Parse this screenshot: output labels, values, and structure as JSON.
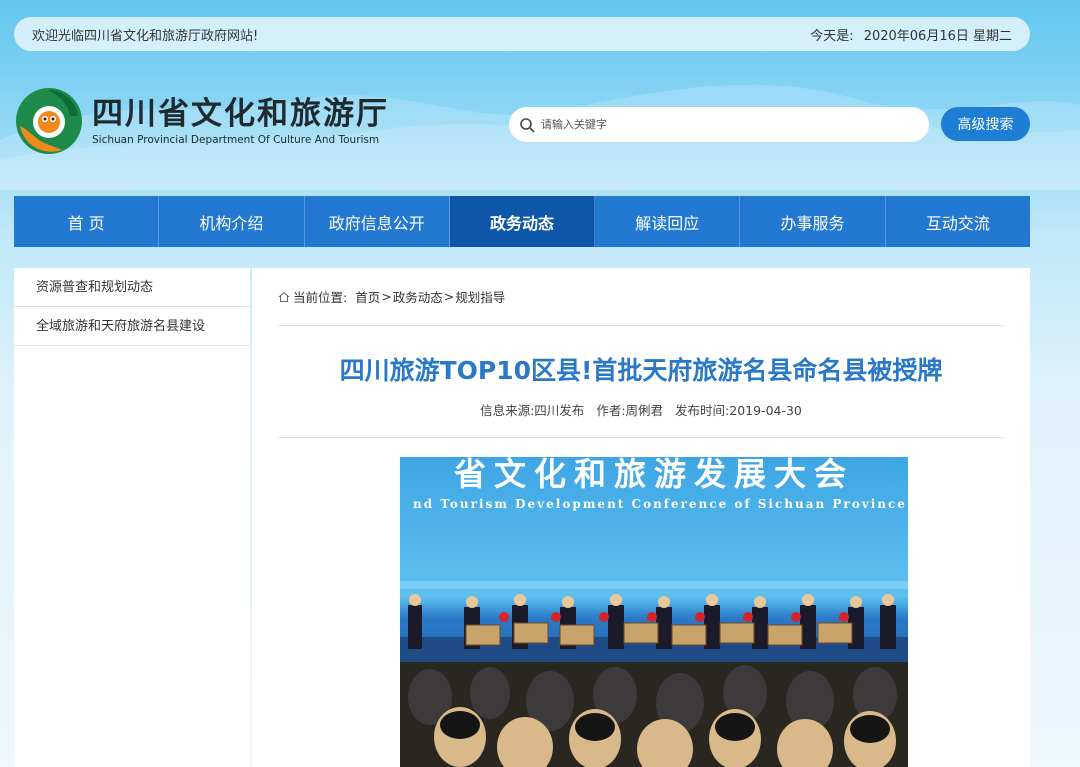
{
  "topbar": {
    "welcome": "欢迎光临四川省文化和旅游厅政府网站!",
    "date_label": "今天是:",
    "date_value": "2020年06月16日 星期二"
  },
  "logo": {
    "name_cn": "四川省文化和旅游厅",
    "name_en": "Sichuan Provincial Department Of Culture And Tourism"
  },
  "search": {
    "placeholder": "请输入关键字",
    "advanced_label": "高级搜索"
  },
  "nav": {
    "items": [
      {
        "label": "首 页"
      },
      {
        "label": "机构介绍"
      },
      {
        "label": "政府信息公开"
      },
      {
        "label": "政务动态"
      },
      {
        "label": "解读回应"
      },
      {
        "label": "办事服务"
      },
      {
        "label": "互动交流"
      }
    ],
    "active_index": 3
  },
  "sidebar": {
    "items": [
      {
        "label": "资源普查和规划动态"
      },
      {
        "label": "全域旅游和天府旅游名县建设"
      }
    ]
  },
  "breadcrumb": {
    "prefix": "当前位置:",
    "home": "首页",
    "level1": "政务动态",
    "level2": "规划指导",
    "separator": ">"
  },
  "article": {
    "title": "四川旅游TOP10区县!首批天府旅游名县命名县被授牌",
    "source": "信息来源:四川发布",
    "author": "作者:周俐君",
    "published": "发布时间:2019-04-30",
    "photo_banner_cn": "省文化和旅游发展大会",
    "photo_banner_en": "nd Tourism Development Conference of Sichuan Province"
  },
  "colors": {
    "nav_bg": "#2378d1",
    "nav_active": "#0e56a8",
    "title_blue": "#2a78c8",
    "button_blue": "#1e7ed4"
  }
}
